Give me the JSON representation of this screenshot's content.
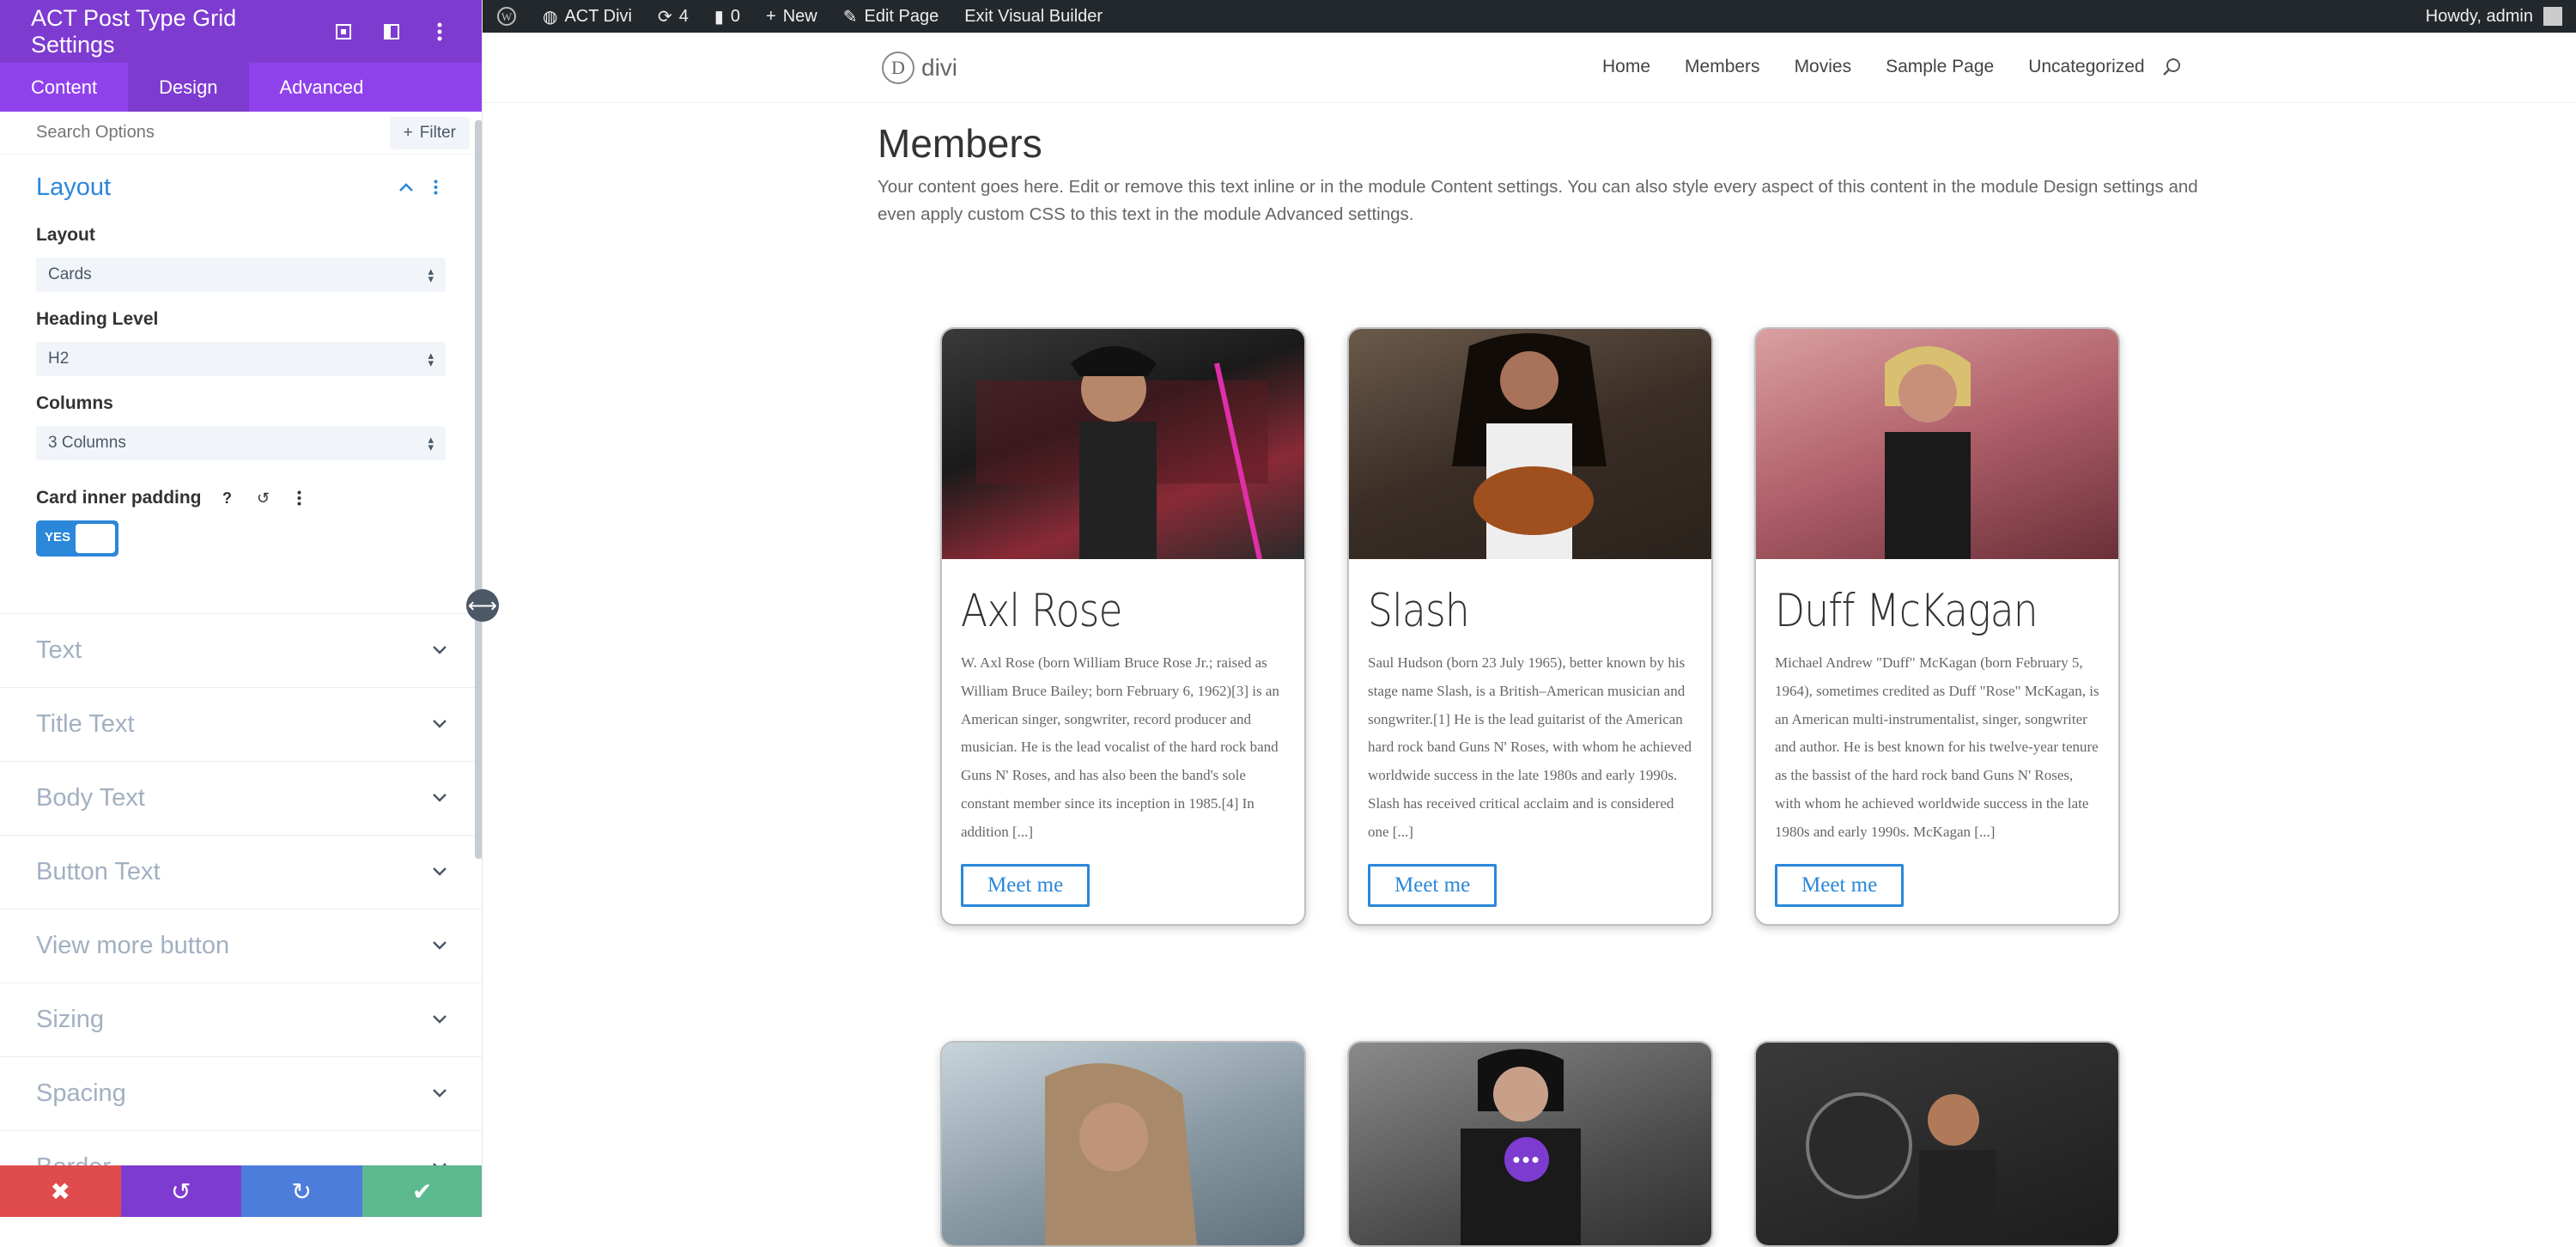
{
  "panel": {
    "title": "ACT Post Type Grid Settings",
    "tabs": [
      "Content",
      "Design",
      "Advanced"
    ],
    "search_placeholder": "Search Options",
    "filter_label": "Filter",
    "group_title": "Layout",
    "fields": {
      "layout_label": "Layout",
      "layout_value": "Cards",
      "heading_label": "Heading Level",
      "heading_value": "H2",
      "columns_label": "Columns",
      "columns_value": "3 Columns",
      "padding_label": "Card inner padding",
      "toggle_label": "YES"
    },
    "sections": [
      "Text",
      "Title Text",
      "Body Text",
      "Button Text",
      "View more button",
      "Sizing",
      "Spacing",
      "Border"
    ],
    "footer_colors": {
      "discard": "#e04b4b",
      "undo": "#7e3bd0",
      "redo": "#4d7ddb",
      "save": "#5cb88f"
    }
  },
  "adminbar": {
    "site_name": "ACT Divi",
    "updates_count": "4",
    "comments_count": "0",
    "new_label": "New",
    "edit_label": "Edit Page",
    "exit_label": "Exit Visual Builder",
    "greeting": "Howdy, admin"
  },
  "site": {
    "logo_letter": "D",
    "logo_text": "divi",
    "nav": [
      "Home",
      "Members",
      "Movies",
      "Sample Page",
      "Uncategorized"
    ]
  },
  "content": {
    "title": "Members",
    "intro": "Your content goes here. Edit or remove this text inline or in the module Content settings. You can also style every aspect of this content in the module Design settings and even apply custom CSS to this text in the module Advanced settings.",
    "cards": [
      {
        "name": "Axl Rose",
        "text": "W. Axl Rose (born William Bruce Rose Jr.; raised as William Bruce Bailey; born February 6, 1962)[3] is an American singer, songwriter, record producer and musician. He is the lead vocalist of the hard rock band Guns N' Roses, and has also been the band's sole constant member since its inception in 1985.[4] In addition [...]",
        "button": "Meet me"
      },
      {
        "name": "Slash",
        "text": "Saul Hudson (born 23 July 1965), better known by his stage name Slash, is a British–American musician and songwriter.[1] He is the lead guitarist of the American hard rock band Guns N' Roses, with whom he achieved worldwide success in the late 1980s and early 1990s. Slash has received critical acclaim and is considered one [...]",
        "button": "Meet me"
      },
      {
        "name": "Duff McKagan",
        "text": "Michael Andrew \"Duff\" McKagan (born February 5, 1964), sometimes credited as Duff \"Rose\" McKagan, is an American multi-instrumentalist, singer, songwriter and author. He is best known for his twelve-year tenure as the bassist of the hard rock band Guns N' Roses, with whom he achieved worldwide success in the late 1980s and early 1990s. McKagan [...]",
        "button": "Meet me"
      }
    ],
    "fab_label": "•••"
  }
}
